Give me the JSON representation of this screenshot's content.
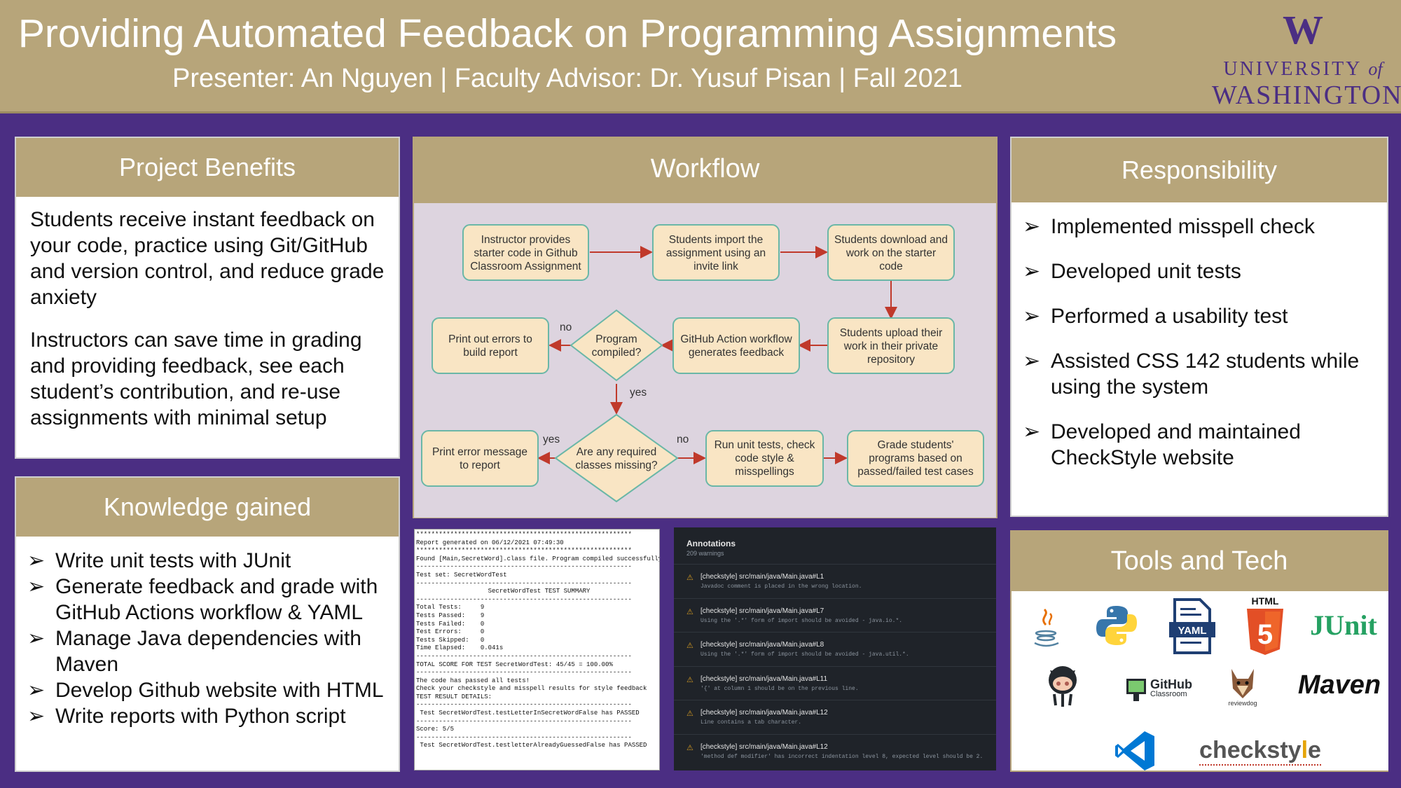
{
  "header": {
    "title": "Providing Automated Feedback on Programming Assignments",
    "subtitle": "Presenter: An Nguyen | Faculty Advisor: Dr. Yusuf Pisan | Fall 2021",
    "logo_w": "W",
    "logo_line1_a": "UNIVERSITY ",
    "logo_line1_b": "of",
    "logo_line2": "WASHINGTON"
  },
  "benefits": {
    "heading": "Project Benefits",
    "p1": "Students receive instant feedback on your code, practice using Git/GitHub and version control, and reduce grade anxiety",
    "p2": "Instructors can save time in grading and providing feedback, see each student’s contribution, and re-use assignments with minimal setup"
  },
  "knowledge": {
    "heading": "Knowledge gained",
    "bullet": "➢",
    "items": [
      "Write unit tests with JUnit",
      "Generate feedback and grade with GitHub Actions workflow & YAML",
      "Manage Java dependencies with Maven",
      "Develop Github website with HTML",
      "Write reports with Python script"
    ]
  },
  "workflow": {
    "heading": "Workflow",
    "nodes": {
      "n1": [
        "Instructor provides",
        "starter code in Github",
        "Classroom Assignment"
      ],
      "n2": [
        "Students import the",
        "assignment using an",
        "invite link"
      ],
      "n3": [
        "Students download and",
        "work on the starter",
        "code"
      ],
      "n4": [
        "Students upload their",
        "work in their private",
        "repository"
      ],
      "n5": [
        "GitHub Action workflow",
        "generates feedback"
      ],
      "d1": [
        "Program",
        "compiled?"
      ],
      "n6": [
        "Print out errors to",
        "build report"
      ],
      "d2": [
        "Are any required",
        "classes missing?"
      ],
      "n7": [
        "Print error message",
        "to report"
      ],
      "n8": [
        "Run unit tests, check",
        "code style &",
        "misspellings"
      ],
      "n9": [
        "Grade students'",
        "programs based on",
        "passed/failed test cases"
      ]
    },
    "labels": {
      "no1": "no",
      "yes1": "yes",
      "yes2": "yes",
      "no2": "no"
    }
  },
  "report": {
    "lines": [
      "*********************************************************",
      "Report generated on 06/12/2021 07:49:30",
      "*********************************************************",
      "Found [Main,SecretWord].class file. Program compiled successfully. Test",
      "---------------------------------------------------------",
      "Test set: SecretWordTest",
      "---------------------------------------------------------",
      "                   SecretWordTest TEST SUMMARY",
      "---------------------------------------------------------",
      "Total Tests:     9",
      "Tests Passed:    9",
      "Tests Failed:    0",
      "Test Errors:     0",
      "Tests Skipped:   0",
      "Time Elapsed:    0.041s",
      "---------------------------------------------------------",
      "TOTAL SCORE FOR TEST SecretWordTest: 45/45 = 100.00%",
      "---------------------------------------------------------",
      "",
      "The code has passed all tests!",
      "Check your checkstyle and misspell results for style feedback",
      "",
      "TEST RESULT DETAILS:",
      "---------------------------------------------------------",
      " Test SecretWordTest.testLetterInSecretWordFalse has PASSED",
      "---------------------------------------------------------",
      "Score: 5/5",
      "---------------------------------------------------------",
      " Test SecretWordTest.testletterAlreadyGuessedFalse has PASSED"
    ]
  },
  "annotations": {
    "title": "Annotations",
    "subtitle": "209 warnings",
    "rows": [
      {
        "t1": "[checkstyle] src/main/java/Main.java#L1",
        "t2": "Javadoc comment is placed in the wrong location."
      },
      {
        "t1": "[checkstyle] src/main/java/Main.java#L7",
        "t2": "Using the '.*' form of import should be avoided - java.io.*."
      },
      {
        "t1": "[checkstyle] src/main/java/Main.java#L8",
        "t2": "Using the '.*' form of import should be avoided - java.util.*."
      },
      {
        "t1": "[checkstyle] src/main/java/Main.java#L11",
        "t2": "'{' at column 1 should be on the previous line."
      },
      {
        "t1": "[checkstyle] src/main/java/Main.java#L12",
        "t2": "Line contains a tab character."
      },
      {
        "t1": "[checkstyle] src/main/java/Main.java#L12",
        "t2": "'method def modifier' has incorrect indentation level 8, expected level should be 2."
      }
    ]
  },
  "responsibility": {
    "heading": "Responsibility",
    "bullet": "➢",
    "items": [
      "Implemented misspell check",
      "Developed unit tests",
      "Performed a usability test",
      "Assisted CSS 142 students while using the system",
      "Developed and maintained CheckStyle website"
    ]
  },
  "tools": {
    "heading": "Tools and Tech",
    "html_label": "HTML",
    "html_num": "5",
    "yaml_label": "YAML",
    "junit": "JUnit",
    "github_classroom": "GitHub",
    "classroom_sub": "Classroom",
    "reviewdog": "reviewdog",
    "maven": "Maven",
    "checkstyle_a": "checksty",
    "checkstyle_b": "l",
    "checkstyle_c": "e"
  },
  "colors": {
    "purple": "#4b2e83",
    "gold": "#b7a57a",
    "node_fill": "#f9e5c4",
    "node_border": "#6ab7a7",
    "arrow": "#c0392b"
  }
}
